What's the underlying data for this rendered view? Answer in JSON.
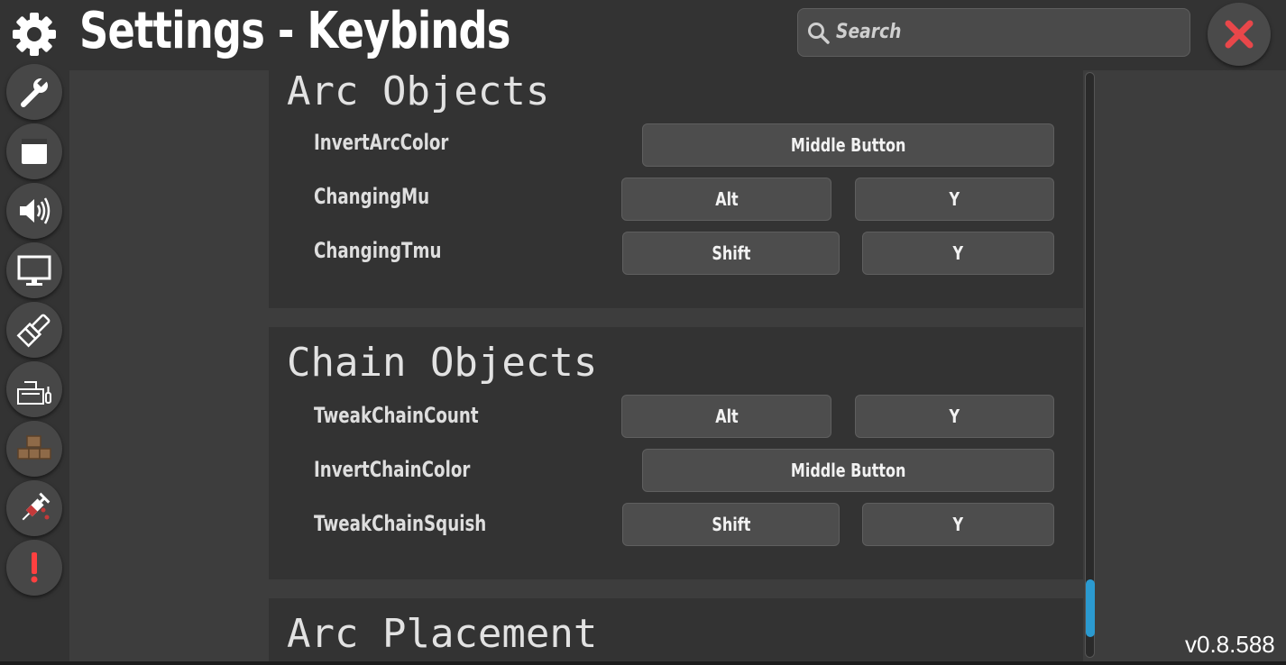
{
  "header": {
    "title": "Settings - Keybinds",
    "search_placeholder": "Search"
  },
  "sidebar": {
    "items": [
      {
        "icon": "wrench-icon"
      },
      {
        "icon": "window-icon"
      },
      {
        "icon": "speaker-icon"
      },
      {
        "icon": "monitor-icon"
      },
      {
        "icon": "paint-brush-icon"
      },
      {
        "icon": "keyboard-icon"
      },
      {
        "icon": "bricks-icon"
      },
      {
        "icon": "syringe-icon"
      },
      {
        "icon": "exclamation-icon"
      }
    ]
  },
  "sections": [
    {
      "title": "Arc Objects",
      "rows": [
        {
          "label": "InvertArcColor",
          "keys": [
            "Middle Button"
          ]
        },
        {
          "label": "ChangingMu",
          "keys": [
            "Alt",
            "Y"
          ]
        },
        {
          "label": "ChangingTmu",
          "keys": [
            "Shift",
            "Y"
          ]
        }
      ]
    },
    {
      "title": "Chain Objects",
      "rows": [
        {
          "label": "TweakChainCount",
          "keys": [
            "Alt",
            "Y"
          ]
        },
        {
          "label": "InvertChainColor",
          "keys": [
            "Middle Button"
          ]
        },
        {
          "label": "TweakChainSquish",
          "keys": [
            "Shift",
            "Y"
          ]
        }
      ]
    },
    {
      "title": "Arc Placement",
      "rows": []
    }
  ],
  "version": "v0.8.588",
  "colors": {
    "accent_scroll": "#2b9ad0",
    "close_red": "#e8474a",
    "panel_bg": "#333333",
    "page_bg": "#3d3d3d"
  }
}
